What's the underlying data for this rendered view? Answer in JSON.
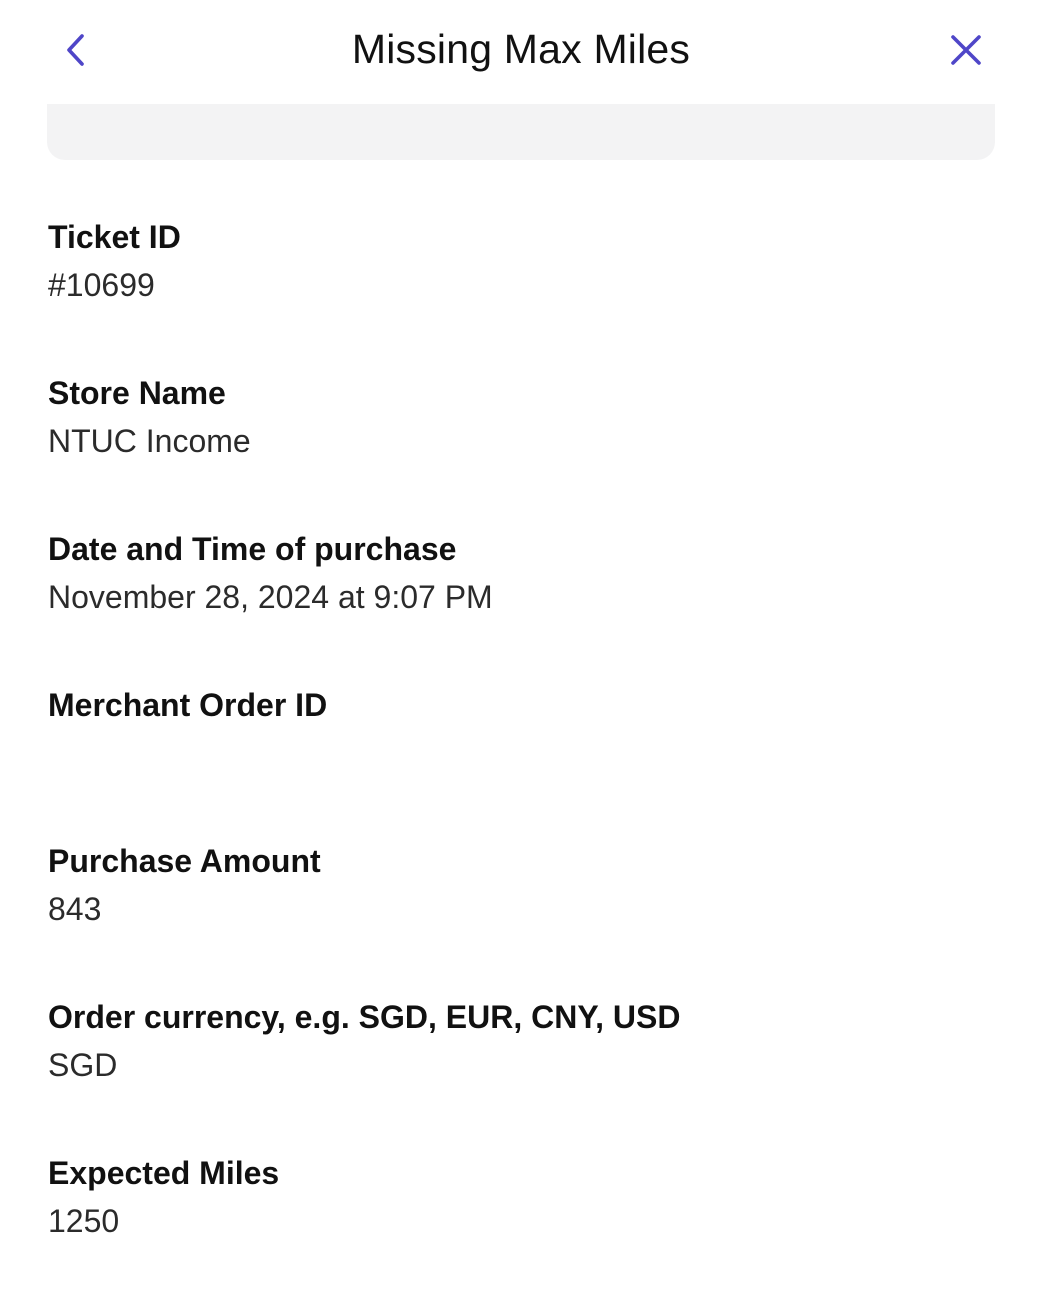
{
  "header": {
    "title": "Missing Max Miles",
    "back_icon": "chevron-left-icon",
    "close_icon": "close-icon",
    "accent_color": "#4f46c8"
  },
  "fields": [
    {
      "label": "Ticket ID",
      "value": "#10699"
    },
    {
      "label": "Store Name",
      "value": "NTUC Income"
    },
    {
      "label": "Date and Time of purchase",
      "value": "November 28, 2024 at 9:07 PM"
    },
    {
      "label": "Merchant Order ID",
      "value": ""
    },
    {
      "label": "Purchase Amount",
      "value": "843"
    },
    {
      "label": "Order currency, e.g. SGD, EUR, CNY, USD",
      "value": "SGD"
    },
    {
      "label": "Expected Miles",
      "value": "1250"
    }
  ]
}
